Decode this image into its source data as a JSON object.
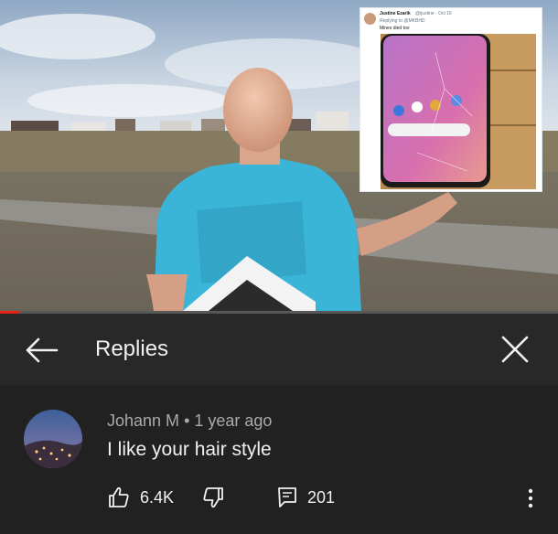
{
  "video": {
    "progress_fraction": 0.034,
    "embedded_tweet": {
      "author": "Justine Ezarik",
      "handle": "@ijustine · Oct 16",
      "reply_to": "Replying to @MKBHD",
      "text": "Mines died too"
    }
  },
  "header": {
    "title": "Replies",
    "back_icon": "arrow-left-icon",
    "close_icon": "close-icon"
  },
  "comment": {
    "author": "Johann M",
    "separator": "•",
    "time": "1 year ago",
    "text": "I like your hair style",
    "likes": "6.4K",
    "replies": "201"
  },
  "colors": {
    "background": "#212121",
    "header_background": "#282828",
    "progress": "#e62117",
    "text_primary": "#f1f1f1",
    "text_secondary": "#aaaaaa"
  }
}
